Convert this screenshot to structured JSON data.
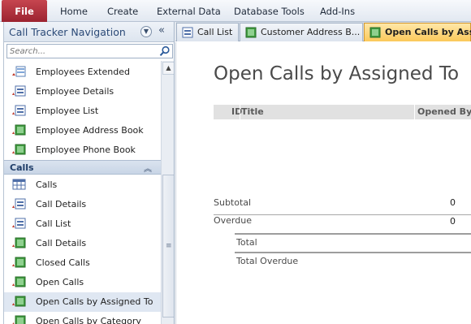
{
  "ribbon": {
    "tabs": [
      "File",
      "Home",
      "Create",
      "External Data",
      "Database Tools",
      "Add-Ins"
    ]
  },
  "nav": {
    "title": "Call Tracker Navigation",
    "search_placeholder": "Search...",
    "group_label": "Calls",
    "items_top": [
      {
        "label": "Employees Extended",
        "icon": "query-icon"
      },
      {
        "label": "Employee Details",
        "icon": "form-icon"
      },
      {
        "label": "Employee List",
        "icon": "form-icon"
      },
      {
        "label": "Employee Address Book",
        "icon": "report-icon"
      },
      {
        "label": "Employee Phone Book",
        "icon": "report-icon"
      }
    ],
    "items_calls": [
      {
        "label": "Calls",
        "icon": "table-icon"
      },
      {
        "label": "Call Details",
        "icon": "form-icon"
      },
      {
        "label": "Call List",
        "icon": "form-icon"
      },
      {
        "label": "Call Details",
        "icon": "report-icon"
      },
      {
        "label": "Closed Calls",
        "icon": "report-icon"
      },
      {
        "label": "Open Calls",
        "icon": "report-icon"
      },
      {
        "label": "Open Calls by Assigned To",
        "icon": "report-icon",
        "selected": true
      },
      {
        "label": "Open Calls by Category",
        "icon": "report-icon"
      }
    ]
  },
  "doc_tabs": [
    {
      "label": "Call List",
      "icon": "form-icon"
    },
    {
      "label": "Customer Address B...",
      "icon": "report-icon"
    },
    {
      "label": "Open Calls by Assig...",
      "icon": "report-icon",
      "active": true
    }
  ],
  "report": {
    "title": "Open Calls by Assigned To",
    "columns": [
      "ID",
      "Title",
      "Opened By"
    ],
    "subtotal_label": "Subtotal",
    "subtotal_value": "0",
    "overdue_label": "Overdue",
    "overdue_value": "0",
    "total_label": "Total",
    "total_overdue_label": "Total Overdue"
  },
  "colors": {
    "file_tab": "#b33240",
    "active_doc_tab": "#fbc95a",
    "group_header": "#c8d5e6",
    "nav_title": "#2b4a77"
  }
}
